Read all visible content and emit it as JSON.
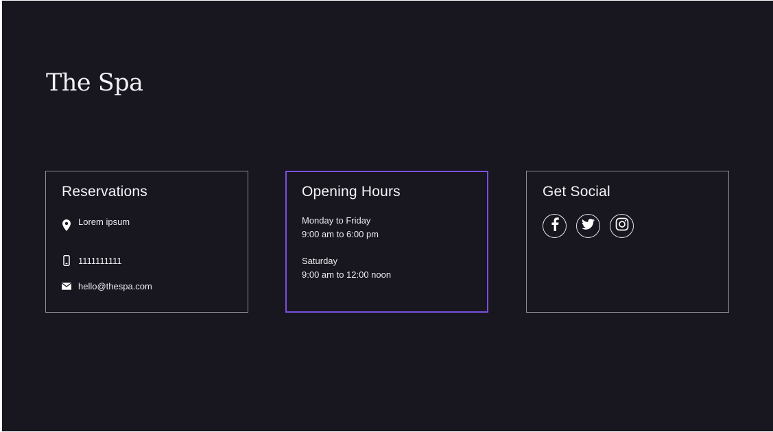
{
  "brand": {
    "title": "The Spa"
  },
  "reservations": {
    "heading": "Reservations",
    "address": "Lorem ipsum",
    "phone": "1111111111",
    "email": "hello@thespa.com",
    "icons": [
      "location-pin-icon",
      "mobile-phone-icon",
      "envelope-icon"
    ]
  },
  "hours": {
    "heading": "Opening Hours",
    "blocks": [
      {
        "days": "Monday to Friday",
        "time": "9:00 am to 6:00 pm"
      },
      {
        "days": "Saturday",
        "time": "9:00 am to 12:00 noon"
      }
    ]
  },
  "social": {
    "heading": "Get Social",
    "links": [
      "facebook-icon",
      "twitter-icon",
      "instagram-icon"
    ]
  },
  "colors": {
    "background": "#18161f",
    "text": "#ffffff",
    "card_border": "#8e8b95",
    "accent_border": "#7b4fe0"
  }
}
